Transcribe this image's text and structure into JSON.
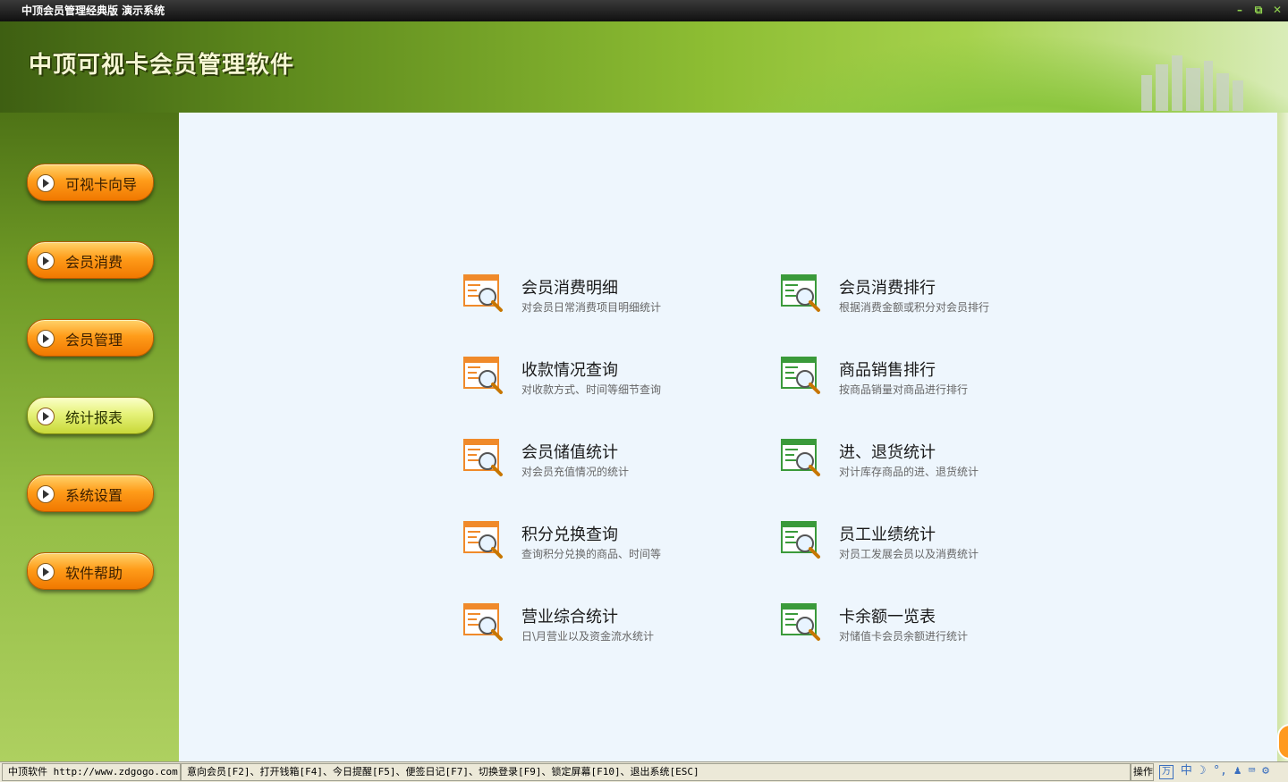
{
  "window": {
    "title": "中顶会员管理经典版 演示系统",
    "controls": {
      "minimize": "–",
      "restore": "⧉",
      "close": "✕"
    }
  },
  "banner": {
    "app_title": "中顶可视卡会员管理软件"
  },
  "sidebar": {
    "items": [
      {
        "label": "可视卡向导"
      },
      {
        "label": "会员消费"
      },
      {
        "label": "会员管理"
      },
      {
        "label": "统计报表",
        "active": true
      },
      {
        "label": "系统设置"
      },
      {
        "label": "软件帮助"
      }
    ]
  },
  "reports": {
    "left": [
      {
        "title": "会员消费明细",
        "desc": "对会员日常消费项目明细统计"
      },
      {
        "title": "收款情况查询",
        "desc": "对收款方式、时间等细节查询"
      },
      {
        "title": "会员储值统计",
        "desc": "对会员充值情况的统计"
      },
      {
        "title": "积分兑换查询",
        "desc": "查询积分兑换的商品、时间等"
      },
      {
        "title": "营业综合统计",
        "desc": "日\\月营业以及资金流水统计"
      }
    ],
    "right": [
      {
        "title": "会员消费排行",
        "desc": "根据消费金额或积分对会员排行"
      },
      {
        "title": "商品销售排行",
        "desc": "按商品销量对商品进行排行"
      },
      {
        "title": "进、退货统计",
        "desc": "对计库存商品的进、退货统计"
      },
      {
        "title": "员工业绩统计",
        "desc": "对员工发展会员以及消费统计"
      },
      {
        "title": "卡余额一览表",
        "desc": "对储值卡会员余额进行统计"
      }
    ]
  },
  "statusbar": {
    "company": "中顶软件 http://www.zdgogo.com",
    "shortcuts": "意向会员[F2]、打开钱箱[F4]、今日提醒[F5]、便签日记[F7]、切换登录[F9]、锁定屏幕[F10]、退出系统[ESC]",
    "operator": "操作员",
    "ime": "中 ☽ °, ♟ ⌨ ⚙"
  },
  "colors": {
    "accent_orange": "#ff9c1a",
    "active_yellow": "#e6f27a",
    "panel_bg": "#eef6fd",
    "icon_orange": "#f08a2a",
    "icon_green": "#3a9a3a"
  }
}
